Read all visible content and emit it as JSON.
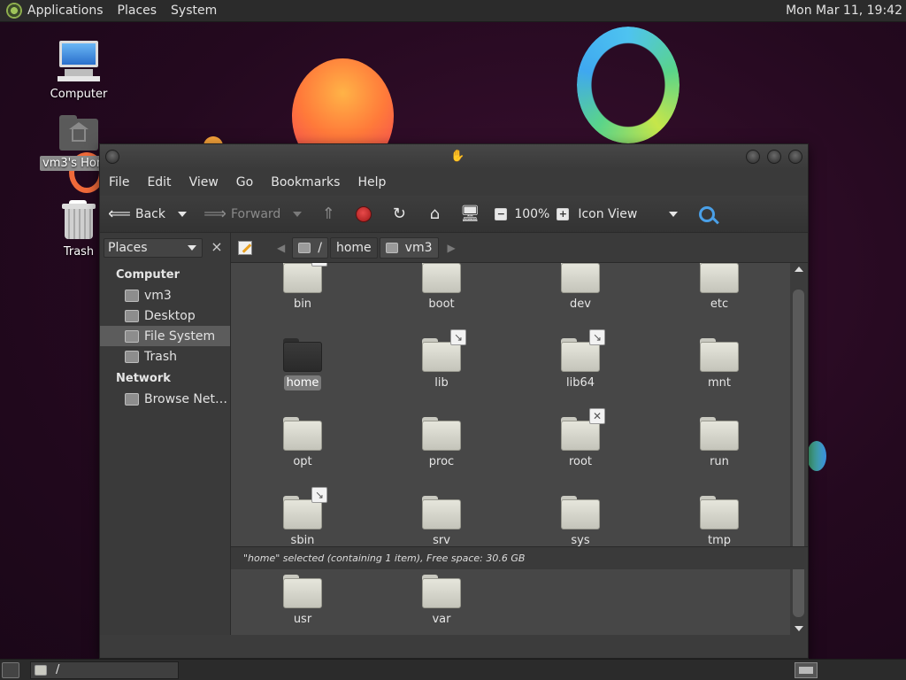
{
  "top_panel": {
    "menus": [
      "Applications",
      "Places",
      "System"
    ],
    "clock": "Mon Mar 11, 19:42"
  },
  "desktop": {
    "icons": [
      {
        "label": "Computer",
        "icon": "computer-icon"
      },
      {
        "label": "vm3's Home",
        "icon": "home-folder-icon"
      },
      {
        "label": "Trash",
        "icon": "trash-icon"
      }
    ]
  },
  "window": {
    "menubar": [
      "File",
      "Edit",
      "View",
      "Go",
      "Bookmarks",
      "Help"
    ],
    "toolbar": {
      "back_label": "Back",
      "forward_label": "Forward",
      "zoom_level": "100%",
      "view_mode": "Icon View"
    },
    "sidebar": {
      "selector_label": "Places",
      "sections": [
        {
          "title": "Computer",
          "items": [
            {
              "label": "vm3",
              "icon": "home-icon"
            },
            {
              "label": "Desktop",
              "icon": "desktop-icon"
            },
            {
              "label": "File System",
              "icon": "drive-icon",
              "selected": true
            },
            {
              "label": "Trash",
              "icon": "trash-icon"
            }
          ]
        },
        {
          "title": "Network",
          "items": [
            {
              "label": "Browse Net…",
              "icon": "network-icon"
            }
          ]
        }
      ]
    },
    "pathbar": {
      "segments": [
        "/",
        "home",
        "vm3"
      ]
    },
    "files": [
      {
        "name": "bin",
        "emblem": "symlink"
      },
      {
        "name": "boot"
      },
      {
        "name": "dev"
      },
      {
        "name": "etc"
      },
      {
        "name": "home",
        "selected": true
      },
      {
        "name": "lib",
        "emblem": "symlink"
      },
      {
        "name": "lib64",
        "emblem": "symlink"
      },
      {
        "name": "mnt"
      },
      {
        "name": "opt"
      },
      {
        "name": "proc"
      },
      {
        "name": "root",
        "emblem": "locked"
      },
      {
        "name": "run"
      },
      {
        "name": "sbin",
        "emblem": "symlink"
      },
      {
        "name": "srv"
      },
      {
        "name": "sys"
      },
      {
        "name": "tmp"
      },
      {
        "name": "usr"
      },
      {
        "name": "var"
      }
    ],
    "status": "\"home\" selected (containing 1 item), Free space: 30.6 GB"
  },
  "bottom_panel": {
    "task_label": "/"
  }
}
